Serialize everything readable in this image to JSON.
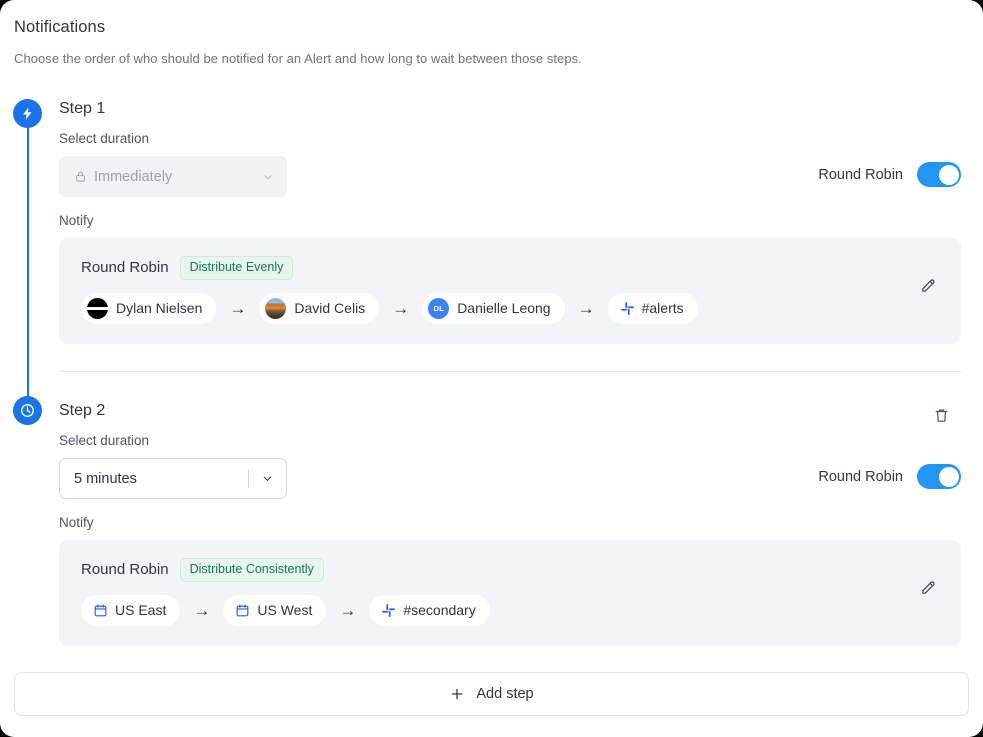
{
  "header": {
    "title": "Notifications",
    "subtitle": "Choose the order of who should be notified for an Alert and how long to wait between those steps."
  },
  "labels": {
    "select_duration": "Select duration",
    "notify": "Notify",
    "round_robin": "Round Robin"
  },
  "colors": {
    "accent_blue": "#1a73e8",
    "toggle_on": "#2196f3",
    "badge_green_text": "#1a7a4e",
    "badge_green_bg": "#e7f5ec",
    "panel_bg": "#f2f4f7"
  },
  "steps": [
    {
      "title": "Step 1",
      "bullet_icon": "lightning-bolt-icon",
      "duration": {
        "value": "Immediately",
        "disabled": true,
        "lock_icon": "lock-icon",
        "chevron_icon": "chevron-down-icon"
      },
      "round_robin_label": "Round Robin",
      "round_robin_enabled": true,
      "notify_label": "Notify",
      "panel": {
        "title": "Round Robin",
        "badge": "Distribute Evenly",
        "edit_icon": "pencil-icon",
        "chain": [
          {
            "label": "Dylan Nielsen",
            "avatar": "photo-dark",
            "initials": ""
          },
          {
            "label": "David Celis",
            "avatar": "photo-outdoor",
            "initials": ""
          },
          {
            "label": "Danielle Leong",
            "avatar": "initials",
            "initials": "DL"
          },
          {
            "label": "#alerts",
            "avatar": "slack-icon",
            "initials": ""
          }
        ]
      }
    },
    {
      "title": "Step 2",
      "bullet_icon": "clock-icon",
      "delete_icon": "trash-icon",
      "duration": {
        "value": "5 minutes",
        "disabled": false,
        "chevron_icon": "chevron-down-icon"
      },
      "round_robin_label": "Round Robin",
      "round_robin_enabled": true,
      "notify_label": "Notify",
      "panel": {
        "title": "Round Robin",
        "badge": "Distribute Consistently",
        "edit_icon": "pencil-icon",
        "chain": [
          {
            "label": "US East",
            "avatar": "calendar-icon",
            "initials": ""
          },
          {
            "label": "US West",
            "avatar": "calendar-icon",
            "initials": ""
          },
          {
            "label": "#secondary",
            "avatar": "slack-icon",
            "initials": ""
          }
        ]
      }
    }
  ],
  "add_step": {
    "label": "Add step",
    "icon": "plus-icon"
  },
  "arrow_glyph": "→"
}
